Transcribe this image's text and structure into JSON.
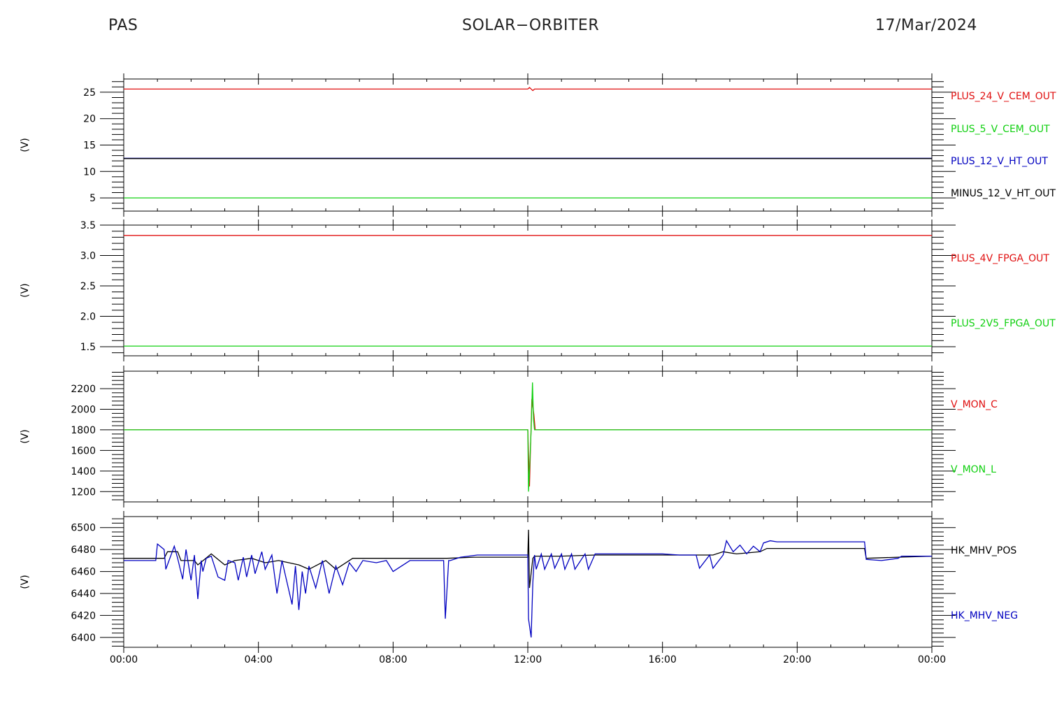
{
  "header": {
    "instrument": "PAS",
    "mission": "SOLAR−ORBITER",
    "date": "17/Mar/2024"
  },
  "colors": {
    "red": "#e01010",
    "green": "#10d010",
    "blue": "#0000c0",
    "black": "#000000"
  },
  "chart_data": [
    {
      "type": "line",
      "ylabel": "(V)",
      "ylim": [
        2.5,
        27.5
      ],
      "yticks": [
        5,
        10,
        15,
        20,
        25
      ],
      "series": [
        {
          "name": "PLUS_24_V_CEM_OUT",
          "color": "red",
          "x": [
            0,
            12.0,
            12.05,
            12.15,
            12.2,
            24
          ],
          "y": [
            25.6,
            25.6,
            25.9,
            25.3,
            25.6,
            25.6
          ]
        },
        {
          "name": "PLUS_5_V_CEM_OUT",
          "color": "green",
          "x": [
            0,
            24
          ],
          "y": [
            5.0,
            5.0
          ]
        },
        {
          "name": "PLUS_12_V_HT_OUT",
          "color": "blue",
          "x": [
            0,
            24
          ],
          "y": [
            12.5,
            12.5
          ]
        },
        {
          "name": "MINUS_12_V_HT_OUT",
          "color": "black",
          "x": [
            0,
            24
          ],
          "y": [
            12.45,
            12.45
          ]
        }
      ]
    },
    {
      "type": "line",
      "ylabel": "(V)",
      "ylim": [
        1.35,
        3.5
      ],
      "yticks": [
        1.5,
        2.0,
        2.5,
        3.0,
        3.5
      ],
      "yticklabels": [
        "1.5",
        "2.0",
        "2.5",
        "3.0",
        "3.5"
      ],
      "series": [
        {
          "name": "PLUS_4V_FPGA_OUT",
          "color": "red",
          "x": [
            0,
            24
          ],
          "y": [
            3.33,
            3.33
          ]
        },
        {
          "name": "PLUS_2V5_FPGA_OUT",
          "color": "green",
          "x": [
            0,
            24
          ],
          "y": [
            1.51,
            1.51
          ]
        }
      ]
    },
    {
      "type": "line",
      "ylabel": "(V)",
      "ylim": [
        1100,
        2370
      ],
      "yticks": [
        1200,
        1400,
        1600,
        1800,
        2000,
        2200
      ],
      "series": [
        {
          "name": "V_MON_C",
          "color": "red",
          "x": [
            0,
            12.0,
            12.05,
            12.12,
            12.18,
            12.22,
            24
          ],
          "y": [
            1800,
            1800,
            1250,
            2100,
            1950,
            1800,
            1800
          ]
        },
        {
          "name": "V_MON_L",
          "color": "green",
          "x": [
            0,
            12.0,
            12.02,
            12.05,
            12.1,
            12.14,
            12.17,
            12.2,
            12.25,
            24
          ],
          "y": [
            1800,
            1800,
            1200,
            1400,
            1800,
            2260,
            1900,
            1800,
            1800,
            1800
          ]
        }
      ]
    },
    {
      "type": "line",
      "ylabel": "(V)",
      "ylim": [
        6391,
        6510
      ],
      "yticks": [
        6400,
        6420,
        6440,
        6460,
        6480,
        6500
      ],
      "series": [
        {
          "name": "HK_MHV_POS",
          "color": "black",
          "x": [
            0,
            1.2,
            1.3,
            1.6,
            1.7,
            2.1,
            2.2,
            2.6,
            3.0,
            3.3,
            3.8,
            4.2,
            4.6,
            5.2,
            5.5,
            6.0,
            6.3,
            6.8,
            7.1,
            9.6,
            10.4,
            12.0,
            12.02,
            12.05,
            12.15,
            12.2,
            13.0,
            14.0,
            16.0,
            17.5,
            17.8,
            18.2,
            18.9,
            19.1,
            20.5,
            22.0,
            22.05,
            23.0,
            24
          ],
          "y": [
            6472,
            6472,
            6478,
            6478,
            6470,
            6470,
            6466,
            6476,
            6466,
            6470,
            6472,
            6468,
            6470,
            6466,
            6462,
            6470,
            6462,
            6472,
            6472,
            6472,
            6473,
            6473,
            6498,
            6445,
            6472,
            6474,
            6474,
            6475,
            6475,
            6475,
            6478,
            6476,
            6478,
            6481,
            6481,
            6481,
            6472,
            6473,
            6474
          ]
        },
        {
          "name": "HK_MHV_NEG",
          "color": "blue",
          "x": [
            0,
            0.95,
            1.0,
            1.2,
            1.25,
            1.5,
            1.6,
            1.75,
            1.85,
            2.0,
            2.1,
            2.2,
            2.3,
            2.35,
            2.45,
            2.6,
            2.8,
            3.0,
            3.1,
            3.3,
            3.4,
            3.55,
            3.65,
            3.8,
            3.9,
            4.1,
            4.2,
            4.4,
            4.55,
            4.7,
            5.0,
            5.1,
            5.2,
            5.3,
            5.4,
            5.5,
            5.7,
            5.9,
            6.1,
            6.3,
            6.5,
            6.7,
            6.9,
            7.1,
            7.5,
            7.8,
            8.0,
            8.5,
            9.0,
            9.5,
            9.55,
            9.65,
            9.7,
            10.0,
            10.5,
            11.0,
            11.5,
            12.0,
            12.02,
            12.1,
            12.15,
            12.2,
            12.25,
            12.4,
            12.5,
            12.7,
            12.8,
            13.0,
            13.1,
            13.3,
            13.4,
            13.7,
            13.8,
            14.0,
            14.1,
            14.2,
            15.0,
            16.0,
            16.5,
            17.0,
            17.1,
            17.4,
            17.5,
            17.8,
            17.9,
            18.1,
            18.3,
            18.5,
            18.7,
            18.9,
            19.0,
            19.2,
            19.4,
            20.0,
            21.0,
            22.0,
            22.05,
            22.5,
            23.0,
            23.1,
            23.4,
            24
          ],
          "y": [
            6470,
            6470,
            6485,
            6480,
            6462,
            6483,
            6472,
            6453,
            6480,
            6452,
            6475,
            6435,
            6470,
            6460,
            6472,
            6474,
            6455,
            6452,
            6470,
            6468,
            6452,
            6473,
            6455,
            6475,
            6458,
            6478,
            6462,
            6475,
            6440,
            6470,
            6430,
            6465,
            6425,
            6460,
            6440,
            6465,
            6445,
            6470,
            6440,
            6465,
            6448,
            6468,
            6460,
            6470,
            6468,
            6470,
            6460,
            6470,
            6470,
            6470,
            6417,
            6470,
            6470,
            6473,
            6475,
            6475,
            6475,
            6475,
            6417,
            6400,
            6450,
            6475,
            6462,
            6476,
            6462,
            6476,
            6463,
            6476,
            6462,
            6476,
            6462,
            6476,
            6462,
            6476,
            6476,
            6476,
            6476,
            6476,
            6475,
            6475,
            6463,
            6475,
            6463,
            6475,
            6488,
            6478,
            6484,
            6476,
            6483,
            6478,
            6486,
            6488,
            6487,
            6487,
            6487,
            6487,
            6471,
            6470,
            6472,
            6474,
            6474,
            6474
          ]
        }
      ]
    }
  ],
  "xaxis": {
    "xlim": [
      0,
      24
    ],
    "ticks": [
      0,
      4,
      8,
      12,
      16,
      20,
      24
    ],
    "ticklabels": [
      "00:00",
      "04:00",
      "08:00",
      "12:00",
      "16:00",
      "20:00",
      "00:00"
    ]
  }
}
